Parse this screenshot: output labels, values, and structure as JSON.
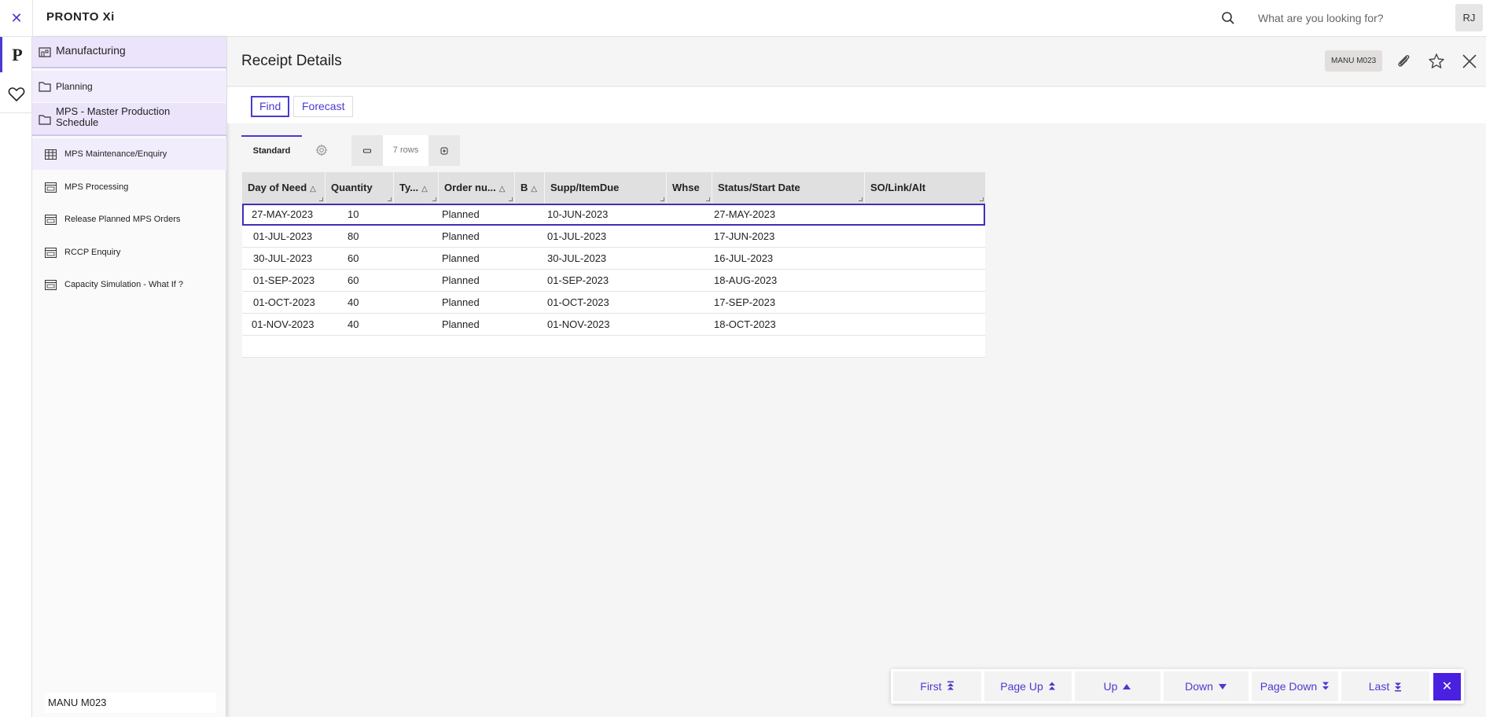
{
  "app": {
    "logo": "PRONTO Xi",
    "close_glyph": "✕",
    "search_placeholder": "What are you looking for?",
    "user_initials": "RJ",
    "rail_logo": "P"
  },
  "sidebar": {
    "breadcrumb": [
      {
        "label": "Manufacturing",
        "icon": "building-folder-icon"
      },
      {
        "label": "Planning",
        "icon": "folder-icon"
      },
      {
        "label": "MPS - Master Production Schedule",
        "icon": "folder-icon"
      }
    ],
    "items": [
      {
        "label": "MPS Maintenance/Enquiry",
        "icon": "table-icon",
        "selected": true
      },
      {
        "label": "MPS Processing",
        "icon": "screen-icon"
      },
      {
        "label": "Release Planned MPS Orders",
        "icon": "screen-icon"
      },
      {
        "label": "RCCP Enquiry",
        "icon": "screen-icon"
      },
      {
        "label": "Capacity Simulation - What If ?",
        "icon": "screen-icon"
      }
    ],
    "footer": "MANU M023"
  },
  "header": {
    "title": "Receipt Details",
    "badge": "MANU M023"
  },
  "toolbar": {
    "find_label": "Find",
    "forecast_label": "Forecast"
  },
  "view": {
    "tab_label": "Standard",
    "rows_label": "7 rows"
  },
  "grid": {
    "columns": [
      {
        "label": "Day of Need",
        "sort": "△"
      },
      {
        "label": "Quantity",
        "sort": ""
      },
      {
        "label": "Ty...",
        "sort": "△"
      },
      {
        "label": "Order nu...",
        "sort": "△"
      },
      {
        "label": "B",
        "sort": "△"
      },
      {
        "label": "Supp/ItemDue",
        "sort": ""
      },
      {
        "label": "Whse",
        "sort": ""
      },
      {
        "label": "Status/Start Date",
        "sort": ""
      },
      {
        "label": "SO/Link/Alt",
        "sort": ""
      }
    ],
    "rows": [
      {
        "day": "27-MAY-2023",
        "qty": "10",
        "order": "Planned",
        "due": "10-JUN-2023",
        "start": "27-MAY-2023"
      },
      {
        "day": "01-JUL-2023",
        "qty": "80",
        "order": "Planned",
        "due": "01-JUL-2023",
        "start": "17-JUN-2023"
      },
      {
        "day": "30-JUL-2023",
        "qty": "60",
        "order": "Planned",
        "due": "30-JUL-2023",
        "start": "16-JUL-2023"
      },
      {
        "day": "01-SEP-2023",
        "qty": "60",
        "order": "Planned",
        "due": "01-SEP-2023",
        "start": "18-AUG-2023"
      },
      {
        "day": "01-OCT-2023",
        "qty": "40",
        "order": "Planned",
        "due": "01-OCT-2023",
        "start": "17-SEP-2023"
      },
      {
        "day": "01-NOV-2023",
        "qty": "40",
        "order": "Planned",
        "due": "01-NOV-2023",
        "start": "18-OCT-2023"
      }
    ]
  },
  "pager": {
    "first": "First",
    "page_up": "Page Up",
    "up": "Up",
    "down": "Down",
    "page_down": "Page Down",
    "last": "Last",
    "close_glyph": "✕"
  },
  "colors": {
    "accent": "#4a3bd0",
    "sidebar_highlight": "#ebe4fb",
    "pager_close": "#4a21e0"
  }
}
